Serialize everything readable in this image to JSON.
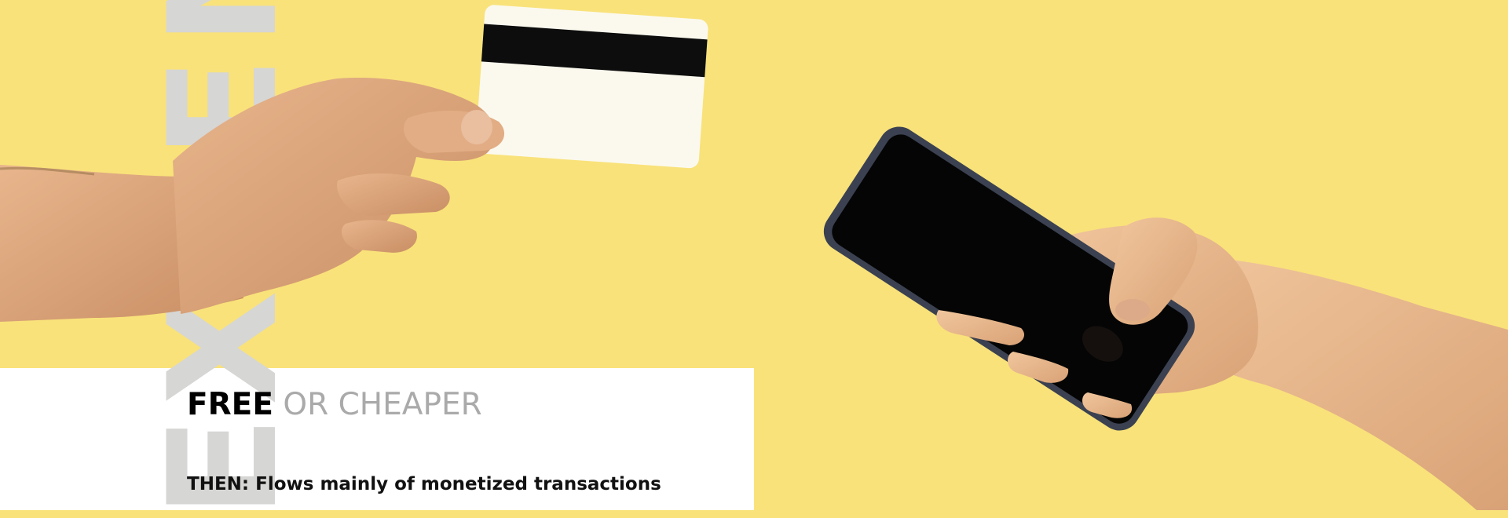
{
  "vertical_word": "EXPENSIVE",
  "headline": {
    "strong": "FREE",
    "light": "OR CHEAPER"
  },
  "subline": "THEN: Flows mainly of monetized transactions",
  "colors": {
    "background": "#f9e27a",
    "panel": "#ffffff",
    "watermark": "#d6d6d4",
    "headline_light": "#aaaaaa",
    "card_stripe": "#0d0d0d",
    "phone_screen": "#050505",
    "phone_case": "#3b4150",
    "skin": "#e9b98d"
  },
  "icons": [
    "hand-with-card",
    "hand-with-phone"
  ]
}
